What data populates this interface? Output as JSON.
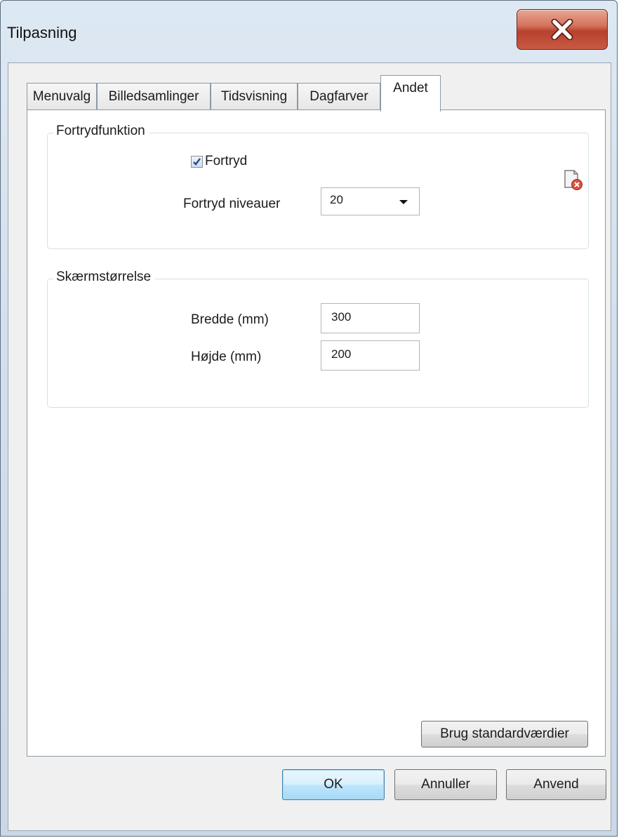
{
  "window": {
    "title": "Tilpasning"
  },
  "tabs": [
    {
      "label": "Menuvalg"
    },
    {
      "label": "Billedsamlinger"
    },
    {
      "label": "Tidsvisning"
    },
    {
      "label": "Dagfarver"
    },
    {
      "label": "Andet",
      "active": true
    }
  ],
  "undo_group": {
    "title": "Fortrydfunktion",
    "undo_checkbox_label": "Fortryd",
    "undo_checked": true,
    "levels_label": "Fortryd niveauer",
    "levels_value": "20"
  },
  "screen_group": {
    "title": "Skærmstørrelse",
    "width_label": "Bredde (mm)",
    "width_value": "300",
    "height_label": "Højde (mm)",
    "height_value": "200"
  },
  "buttons": {
    "defaults": "Brug standardværdier",
    "ok": "OK",
    "cancel": "Annuller",
    "apply": "Anvend"
  }
}
